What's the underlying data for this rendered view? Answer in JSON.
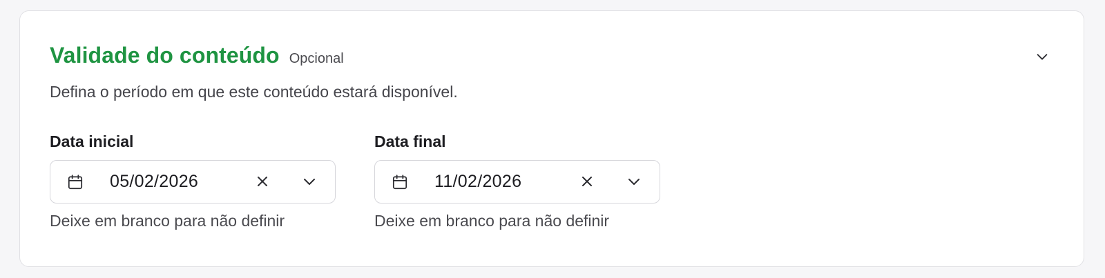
{
  "section": {
    "title": "Validade do conteúdo",
    "badge": "Opcional",
    "description": "Defina o período em que este conteúdo estará disponível.",
    "collapse_icon": "chevron-down-icon"
  },
  "fields": {
    "start": {
      "label": "Data inicial",
      "value": "05/02/2026",
      "helper": "Deixe em branco para não definir"
    },
    "end": {
      "label": "Data final",
      "value": "11/02/2026",
      "helper": "Deixe em branco para não definir"
    }
  },
  "colors": {
    "title": "#1f9442",
    "background": "#f6f6f8",
    "card": "#ffffff",
    "border": "#d6d6db"
  }
}
